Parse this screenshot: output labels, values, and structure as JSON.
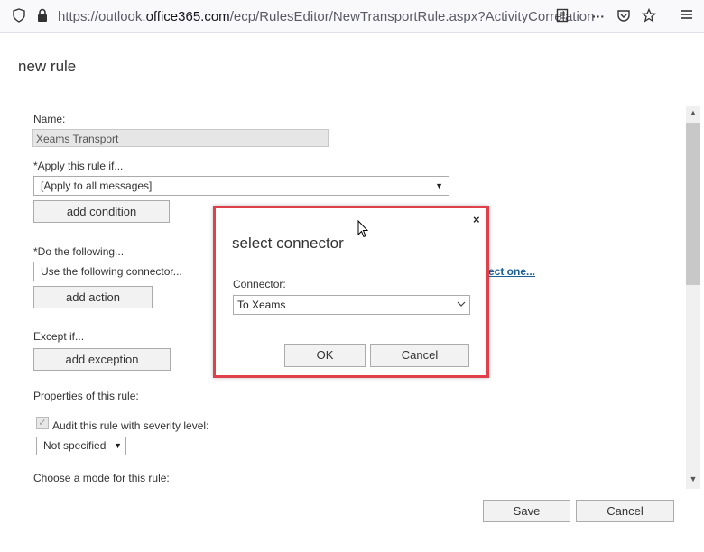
{
  "browser": {
    "url_prefix": "https://outlook.",
    "url_domain": "office365.com",
    "url_path": "/ecp/RulesEditor/NewTransportRule.aspx?ActivityCorrelation"
  },
  "page": {
    "title": "new rule",
    "name_label": "Name:",
    "name_value": "Xeams Transport",
    "apply_label": "*Apply this rule if...",
    "apply_value": "[Apply to all messages]",
    "add_condition": "add condition",
    "do_label": "*Do the following...",
    "do_value": "Use the following connector...",
    "do_link": "ect one...",
    "add_action": "add action",
    "except_label": "Except if...",
    "add_exception": "add exception",
    "properties_label": "Properties of this rule:",
    "audit_label": "Audit this rule with severity level:",
    "severity_value": "Not specified",
    "mode_label": "Choose a mode for this rule:",
    "save": "Save",
    "cancel": "Cancel"
  },
  "dialog": {
    "title": "select connector",
    "close": "×",
    "connector_label": "Connector:",
    "connector_value": "To Xeams",
    "ok": "OK",
    "cancel": "Cancel"
  },
  "colors": {
    "highlight_border": "#e0404a",
    "link": "#1b5f95"
  }
}
